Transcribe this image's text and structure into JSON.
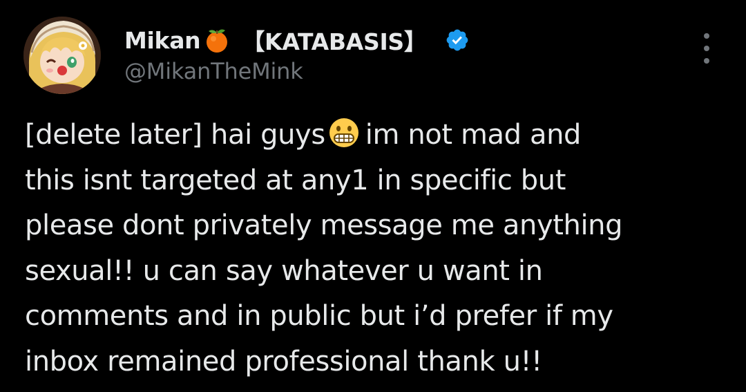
{
  "tweet": {
    "display_name": "Mikan",
    "name_emoji": "tangerine-icon",
    "name_tag": "【KATABASIS】",
    "verified_icon": "verified-badge-icon",
    "handle": "@MikanTheMink",
    "more_icon": "more-options-icon",
    "body": {
      "line1_before": "[delete later] hai guys",
      "inline_emoji": "grimacing-face-icon",
      "line1_after": "im not mad and",
      "line2": "this isnt targeted at any1 in specific but",
      "line3": "please dont privately message me anything",
      "line4": "sexual!! u can say whatever u want in",
      "line5": "comments and in public but i’d prefer if my",
      "line6": "inbox remained professional thank u!!"
    }
  },
  "colors": {
    "background": "#000000",
    "text": "#e7e9ea",
    "secondary": "#71767b",
    "verified": "#1d9bf0"
  }
}
